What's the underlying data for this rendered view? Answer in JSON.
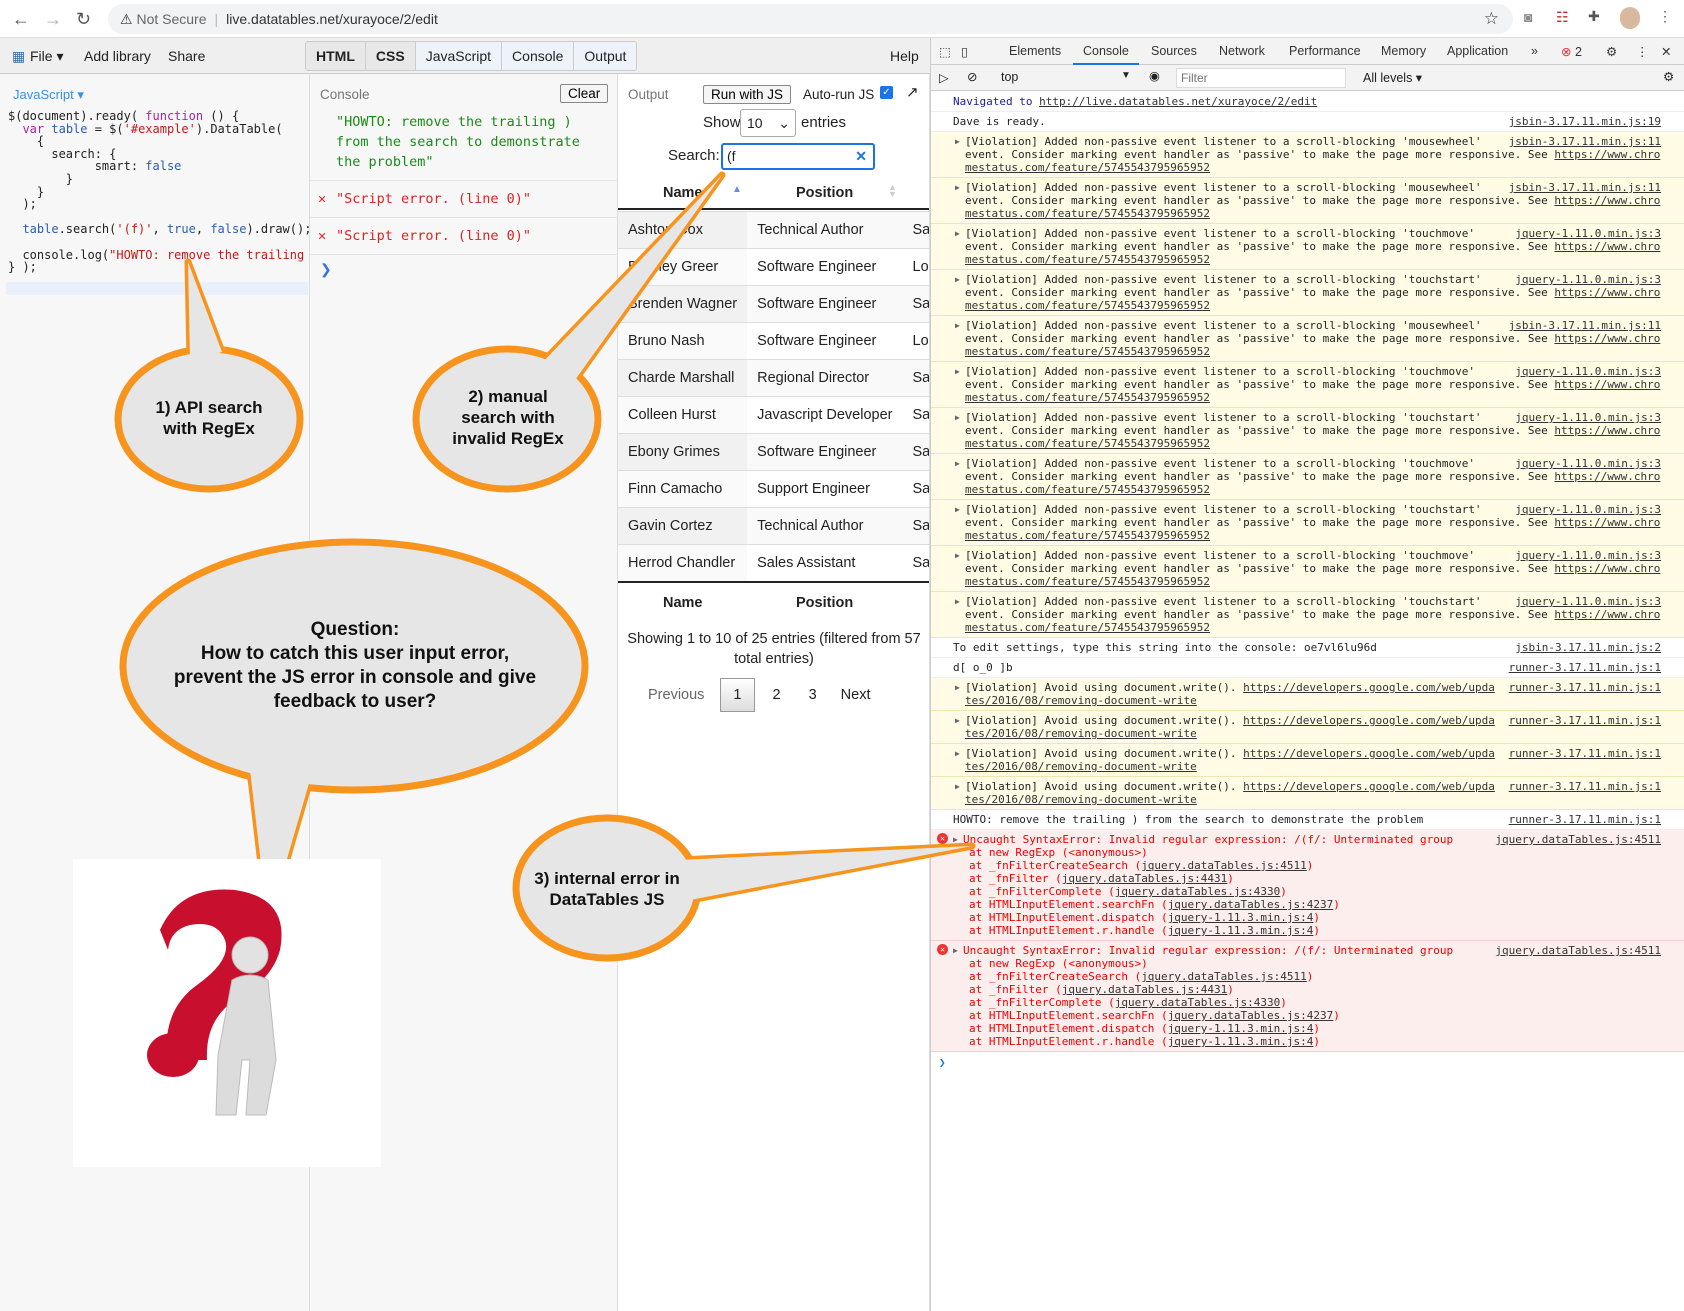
{
  "browser": {
    "not_secure": "Not Secure",
    "url": "live.datatables.net/xurayoce/2/edit"
  },
  "jsbin": {
    "file": "File",
    "add_library": "Add library",
    "share": "Share",
    "help": "Help",
    "tabs": [
      {
        "label": "HTML",
        "active": true
      },
      {
        "label": "CSS",
        "active": true
      },
      {
        "label": "JavaScript",
        "active": false
      },
      {
        "label": "Console",
        "active": false
      },
      {
        "label": "Output",
        "active": false
      }
    ]
  },
  "js_panel": {
    "label": "JavaScript"
  },
  "console_panel": {
    "title": "Console",
    "clear": "Clear",
    "log": "\"HOWTO: remove the trailing ) from the search to demonstrate the problem\"",
    "errors": [
      "\"Script error. (line 0)\"",
      "\"Script error. (line 0)\""
    ],
    "prompt": "❯"
  },
  "output": {
    "label": "Output",
    "run": "Run with JS",
    "autorun": "Auto-run JS",
    "autorun_checked": true,
    "show": "Show",
    "entries_value": "10",
    "entries": "entries",
    "search_label": "Search:",
    "search_value": "(f",
    "columns": [
      "Name",
      "Position"
    ],
    "rows": [
      [
        "Ashton Cox",
        "Technical Author",
        "San Francisco"
      ],
      [
        "Bradley Greer",
        "Software Engineer",
        "London"
      ],
      [
        "Brenden Wagner",
        "Software Engineer",
        "San Francisco"
      ],
      [
        "Bruno Nash",
        "Software Engineer",
        "London"
      ],
      [
        "Charde Marshall",
        "Regional Director",
        "San Francisco"
      ],
      [
        "Colleen Hurst",
        "Javascript Developer",
        "San Francisco"
      ],
      [
        "Ebony Grimes",
        "Software Engineer",
        "San Francisco"
      ],
      [
        "Finn Camacho",
        "Support Engineer",
        "San Francisco"
      ],
      [
        "Gavin Cortez",
        "Technical Author",
        "San Francisco"
      ],
      [
        "Herrod Chandler",
        "Sales Assistant",
        "San Francisco"
      ]
    ],
    "info": "Showing 1 to 10 of 25 entries (filtered from 57 total entries)",
    "pager": {
      "previous": "Previous",
      "pages": [
        "1",
        "2",
        "3"
      ],
      "current": "1",
      "next": "Next"
    }
  },
  "devtools": {
    "tabs": [
      "Elements",
      "Console",
      "Sources",
      "Network",
      "Performance",
      "Memory",
      "Application"
    ],
    "active_tab": "Console",
    "error_count": "2",
    "context": "top",
    "filter_placeholder": "Filter",
    "levels": "All levels",
    "entries": [
      {
        "type": "nav",
        "text": "Navigated to ",
        "link": "http://live.datatables.net/xurayoce/2/edit"
      },
      {
        "type": "plain",
        "text": "Dave is ready.",
        "src": "jsbin-3.17.11.min.js:19"
      },
      {
        "type": "warn",
        "text": "[Violation] Added non-passive event listener to a scroll-blocking 'mousewheel' event. Consider marking event handler as 'passive' to make the page more responsive. See ",
        "link": "https://www.chromestatus.com/feature/5745543795965952",
        "src": "jsbin-3.17.11.min.js:11"
      },
      {
        "type": "warn",
        "text": "[Violation] Added non-passive event listener to a scroll-blocking 'mousewheel' event. Consider marking event handler as 'passive' to make the page more responsive. See ",
        "link": "https://www.chromestatus.com/feature/5745543795965952",
        "src": "jsbin-3.17.11.min.js:11"
      },
      {
        "type": "warn",
        "text": "[Violation] Added non-passive event listener to a scroll-blocking 'touchmove' event. Consider marking event handler as 'passive' to make the page more responsive. See ",
        "link": "https://www.chromestatus.com/feature/5745543795965952",
        "src": "jquery-1.11.0.min.js:3"
      },
      {
        "type": "warn",
        "text": "[Violation] Added non-passive event listener to a scroll-blocking 'touchstart' event. Consider marking event handler as 'passive' to make the page more responsive. See ",
        "link": "https://www.chromestatus.com/feature/5745543795965952",
        "src": "jquery-1.11.0.min.js:3"
      },
      {
        "type": "warn",
        "text": "[Violation] Added non-passive event listener to a scroll-blocking 'mousewheel' event. Consider marking event handler as 'passive' to make the page more responsive. See ",
        "link": "https://www.chromestatus.com/feature/5745543795965952",
        "src": "jsbin-3.17.11.min.js:11"
      },
      {
        "type": "warn",
        "text": "[Violation] Added non-passive event listener to a scroll-blocking 'touchmove' event. Consider marking event handler as 'passive' to make the page more responsive. See ",
        "link": "https://www.chromestatus.com/feature/5745543795965952",
        "src": "jquery-1.11.0.min.js:3"
      },
      {
        "type": "warn",
        "text": "[Violation] Added non-passive event listener to a scroll-blocking 'touchstart' event. Consider marking event handler as 'passive' to make the page more responsive. See ",
        "link": "https://www.chromestatus.com/feature/5745543795965952",
        "src": "jquery-1.11.0.min.js:3"
      },
      {
        "type": "warn",
        "text": "[Violation] Added non-passive event listener to a scroll-blocking 'touchmove' event. Consider marking event handler as 'passive' to make the page more responsive. See ",
        "link": "https://www.chromestatus.com/feature/5745543795965952",
        "src": "jquery-1.11.0.min.js:3"
      },
      {
        "type": "warn",
        "text": "[Violation] Added non-passive event listener to a scroll-blocking 'touchstart' event. Consider marking event handler as 'passive' to make the page more responsive. See ",
        "link": "https://www.chromestatus.com/feature/5745543795965952",
        "src": "jquery-1.11.0.min.js:3"
      },
      {
        "type": "warn",
        "text": "[Violation] Added non-passive event listener to a scroll-blocking 'touchmove' event. Consider marking event handler as 'passive' to make the page more responsive. See ",
        "link": "https://www.chromestatus.com/feature/5745543795965952",
        "src": "jquery-1.11.0.min.js:3"
      },
      {
        "type": "warn",
        "text": "[Violation] Added non-passive event listener to a scroll-blocking 'touchstart' event. Consider marking event handler as 'passive' to make the page more responsive. See ",
        "link": "https://www.chromestatus.com/feature/5745543795965952",
        "src": "jquery-1.11.0.min.js:3"
      },
      {
        "type": "plain",
        "text": "To edit settings, type this string into the console: oe7vl6lu96d",
        "src": "jsbin-3.17.11.min.js:2"
      },
      {
        "type": "plain",
        "text": "d[ o_0 ]b",
        "src": "runner-3.17.11.min.js:1"
      },
      {
        "type": "warn",
        "text": "[Violation] Avoid using document.write(). ",
        "link": "https://developers.google.com/web/updates/2016/08/removing-document-write",
        "src": "runner-3.17.11.min.js:1"
      },
      {
        "type": "warn",
        "text": "[Violation] Avoid using document.write(). ",
        "link": "https://developers.google.com/web/updates/2016/08/removing-document-write",
        "src": "runner-3.17.11.min.js:1"
      },
      {
        "type": "warn",
        "text": "[Violation] Avoid using document.write(). ",
        "link": "https://developers.google.com/web/updates/2016/08/removing-document-write",
        "src": "runner-3.17.11.min.js:1"
      },
      {
        "type": "warn",
        "text": "[Violation] Avoid using document.write(). ",
        "link": "https://developers.google.com/web/updates/2016/08/removing-document-write",
        "src": "runner-3.17.11.min.js:1"
      },
      {
        "type": "plain",
        "text": "HOWTO: remove the trailing ) from the search to demonstrate the problem",
        "src": "runner-3.17.11.min.js:1"
      },
      {
        "type": "err",
        "text": "Uncaught SyntaxError: Invalid regular expression: /(f/: Unterminated group",
        "src": "jquery.dataTables.js:4511",
        "stack": [
          [
            "at new RegExp (<anonymous>)",
            ""
          ],
          [
            "at _fnFilterCreateSearch (",
            "jquery.dataTables.js:4511"
          ],
          [
            "at _fnFilter (",
            "jquery.dataTables.js:4431"
          ],
          [
            "at _fnFilterComplete (",
            "jquery.dataTables.js:4330"
          ],
          [
            "at HTMLInputElement.searchFn (",
            "jquery.dataTables.js:4237"
          ],
          [
            "at HTMLInputElement.dispatch (",
            "jquery-1.11.3.min.js:4"
          ],
          [
            "at HTMLInputElement.r.handle (",
            "jquery-1.11.3.min.js:4"
          ]
        ]
      },
      {
        "type": "err",
        "text": "Uncaught SyntaxError: Invalid regular expression: /(f/: Unterminated group",
        "src": "jquery.dataTables.js:4511",
        "stack": [
          [
            "at new RegExp (<anonymous>)",
            ""
          ],
          [
            "at _fnFilterCreateSearch (",
            "jquery.dataTables.js:4511"
          ],
          [
            "at _fnFilter (",
            "jquery.dataTables.js:4431"
          ],
          [
            "at _fnFilterComplete (",
            "jquery.dataTables.js:4330"
          ],
          [
            "at HTMLInputElement.searchFn (",
            "jquery.dataTables.js:4237"
          ],
          [
            "at HTMLInputElement.dispatch (",
            "jquery-1.11.3.min.js:4"
          ],
          [
            "at HTMLInputElement.r.handle (",
            "jquery-1.11.3.min.js:4"
          ]
        ]
      }
    ]
  },
  "callouts": {
    "c1": "1) API search with RegEx",
    "c2": "2) manual search with invalid RegEx",
    "c3": "3) internal error in DataTables JS",
    "question_title": "Question:",
    "question": "How to catch this user input error, prevent the JS error in console and give feedback to user?"
  },
  "colors": {
    "callout_border": "#f7941d",
    "callout_fill": "#e6e6e6",
    "error_red": "#e00",
    "question_mark": "#c8102e"
  }
}
